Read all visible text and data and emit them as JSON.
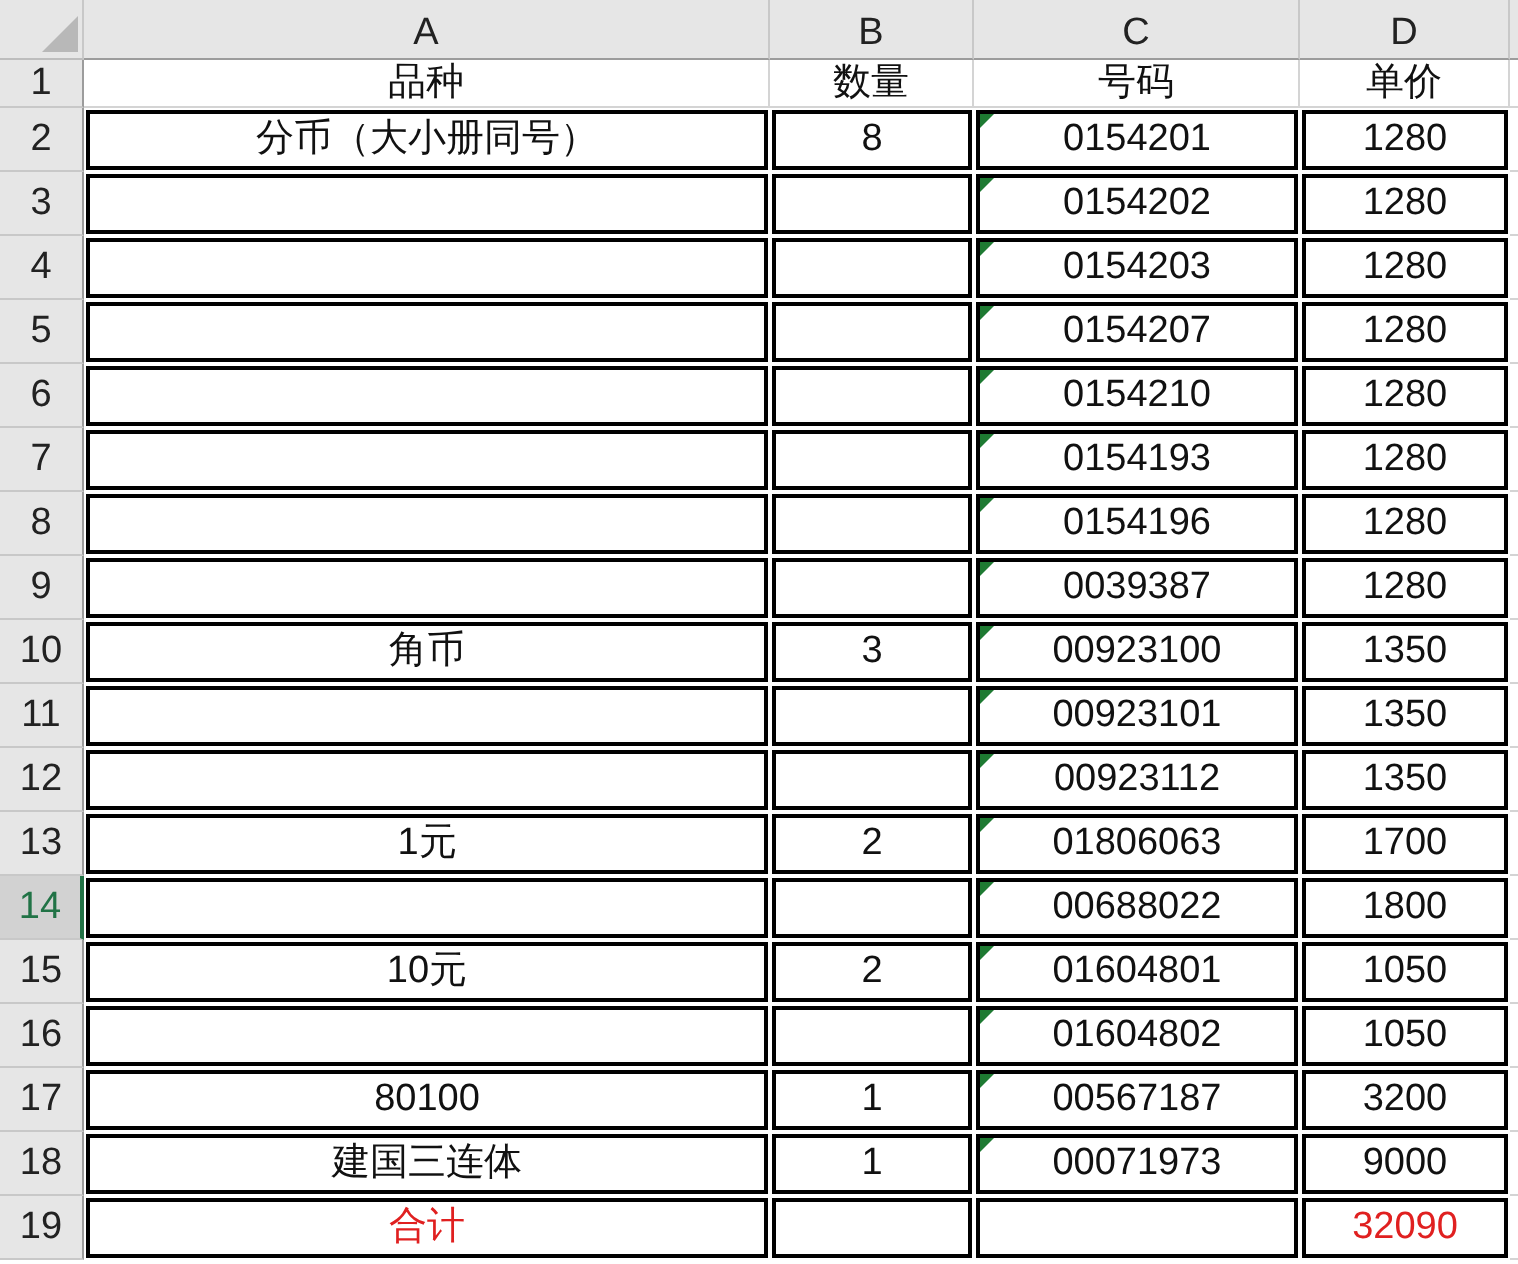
{
  "columns": [
    {
      "label": "A",
      "selected": false
    },
    {
      "label": "B",
      "selected": false
    },
    {
      "label": "C",
      "selected": false
    },
    {
      "label": "D",
      "selected": false
    }
  ],
  "rows": [
    {
      "header": "1",
      "selected": false,
      "boxed": false,
      "cells": [
        {
          "text": "品种"
        },
        {
          "text": "数量"
        },
        {
          "text": "号码"
        },
        {
          "text": "单价"
        }
      ]
    },
    {
      "header": "2",
      "selected": false,
      "boxed": true,
      "cells": [
        {
          "text": "分币（大小册同号）"
        },
        {
          "text": "8"
        },
        {
          "text": "0154201",
          "flagged": true
        },
        {
          "text": "1280"
        }
      ]
    },
    {
      "header": "3",
      "selected": false,
      "boxed": true,
      "cells": [
        {},
        {},
        {
          "text": "0154202",
          "flagged": true
        },
        {
          "text": "1280"
        }
      ]
    },
    {
      "header": "4",
      "selected": false,
      "boxed": true,
      "cells": [
        {},
        {},
        {
          "text": "0154203",
          "flagged": true
        },
        {
          "text": "1280"
        }
      ]
    },
    {
      "header": "5",
      "selected": false,
      "boxed": true,
      "cells": [
        {},
        {},
        {
          "text": "0154207",
          "flagged": true
        },
        {
          "text": "1280"
        }
      ]
    },
    {
      "header": "6",
      "selected": false,
      "boxed": true,
      "cells": [
        {},
        {},
        {
          "text": "0154210",
          "flagged": true
        },
        {
          "text": "1280"
        }
      ]
    },
    {
      "header": "7",
      "selected": false,
      "boxed": true,
      "cells": [
        {},
        {},
        {
          "text": "0154193",
          "flagged": true
        },
        {
          "text": "1280"
        }
      ]
    },
    {
      "header": "8",
      "selected": false,
      "boxed": true,
      "cells": [
        {},
        {},
        {
          "text": "0154196",
          "flagged": true
        },
        {
          "text": "1280"
        }
      ]
    },
    {
      "header": "9",
      "selected": false,
      "boxed": true,
      "cells": [
        {},
        {},
        {
          "text": "0039387",
          "flagged": true
        },
        {
          "text": "1280"
        }
      ]
    },
    {
      "header": "10",
      "selected": false,
      "boxed": true,
      "cells": [
        {
          "text": "角币"
        },
        {
          "text": "3"
        },
        {
          "text": "00923100",
          "flagged": true
        },
        {
          "text": "1350"
        }
      ]
    },
    {
      "header": "11",
      "selected": false,
      "boxed": true,
      "cells": [
        {},
        {},
        {
          "text": "00923101",
          "flagged": true
        },
        {
          "text": "1350"
        }
      ]
    },
    {
      "header": "12",
      "selected": false,
      "boxed": true,
      "cells": [
        {},
        {},
        {
          "text": "00923112",
          "flagged": true
        },
        {
          "text": "1350"
        }
      ]
    },
    {
      "header": "13",
      "selected": false,
      "boxed": true,
      "cells": [
        {
          "text": "1元"
        },
        {
          "text": "2"
        },
        {
          "text": "01806063",
          "flagged": true
        },
        {
          "text": "1700"
        }
      ]
    },
    {
      "header": "14",
      "selected": true,
      "boxed": true,
      "cells": [
        {},
        {},
        {
          "text": "00688022",
          "flagged": true
        },
        {
          "text": "1800"
        }
      ]
    },
    {
      "header": "15",
      "selected": false,
      "boxed": true,
      "cells": [
        {
          "text": "10元"
        },
        {
          "text": "2"
        },
        {
          "text": "01604801",
          "flagged": true
        },
        {
          "text": "1050"
        }
      ]
    },
    {
      "header": "16",
      "selected": false,
      "boxed": true,
      "cells": [
        {},
        {},
        {
          "text": "01604802",
          "flagged": true
        },
        {
          "text": "1050"
        }
      ]
    },
    {
      "header": "17",
      "selected": false,
      "boxed": true,
      "cells": [
        {
          "text": "80100"
        },
        {
          "text": "1"
        },
        {
          "text": "00567187",
          "flagged": true
        },
        {
          "text": "3200"
        }
      ]
    },
    {
      "header": "18",
      "selected": false,
      "boxed": true,
      "cells": [
        {
          "text": "建国三连体"
        },
        {
          "text": "1"
        },
        {
          "text": "00071973",
          "flagged": true
        },
        {
          "text": "9000"
        }
      ]
    },
    {
      "header": "19",
      "selected": false,
      "boxed": true,
      "cells": [
        {
          "text": "合计",
          "color": "#e02020"
        },
        {},
        {},
        {
          "text": "32090",
          "color": "#e02020"
        }
      ]
    }
  ]
}
